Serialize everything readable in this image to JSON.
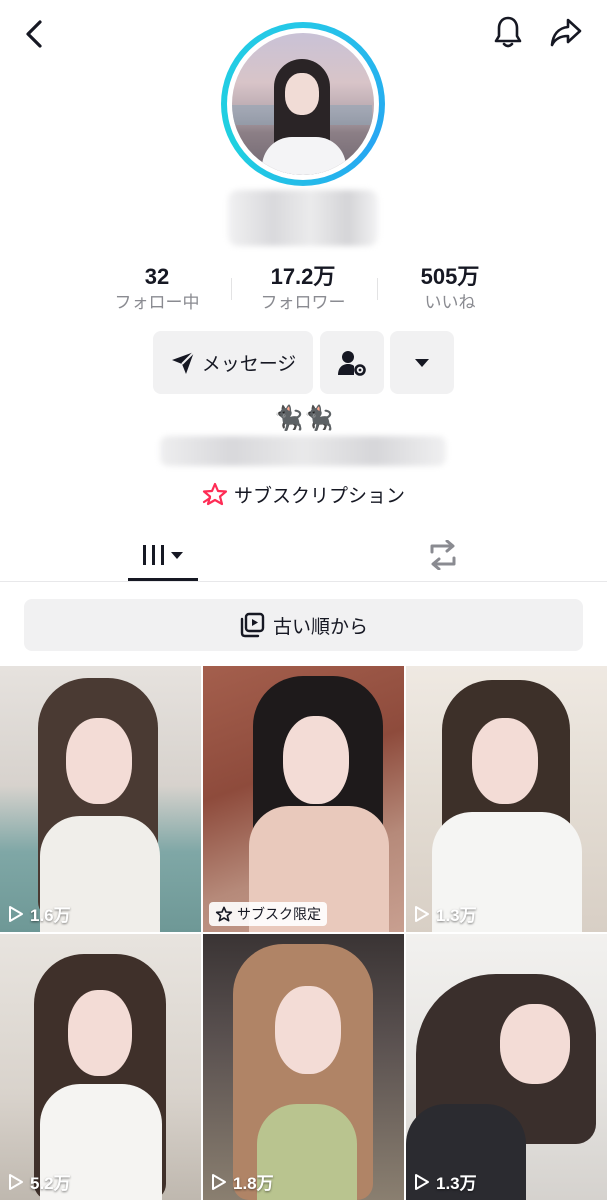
{
  "header": {
    "back_icon": "chevron-left-icon",
    "bell_icon": "bell-icon",
    "share_icon": "share-arrow-icon"
  },
  "profile": {
    "stats": [
      {
        "value": "32",
        "label": "フォロー中"
      },
      {
        "value": "17.2万",
        "label": "フォロワー"
      },
      {
        "value": "505万",
        "label": "いいね"
      }
    ],
    "message_button": "メッセージ",
    "friend_settings_icon": "person-gear-icon",
    "more_icon": "caret-down-icon",
    "bio_emoji": "🐈‍⬛🐈‍⬛",
    "subscription_label": "サブスクリプション"
  },
  "tabs": {
    "videos_icon": "grid-columns-icon",
    "repost_icon": "repost-icon"
  },
  "sort": {
    "label": "古い順から"
  },
  "videos": [
    {
      "views": "1.6万",
      "badge": ""
    },
    {
      "views": "",
      "badge": "サブスク限定"
    },
    {
      "views": "1.3万",
      "badge": ""
    },
    {
      "views": "5.2万",
      "badge": ""
    },
    {
      "views": "1.8万",
      "badge": ""
    },
    {
      "views": "1.3万",
      "badge": ""
    }
  ],
  "colors": {
    "ring": "#25c7e8",
    "button_bg": "#f1f1f2",
    "text": "#161823",
    "muted": "#8a8b91",
    "subscription_pink": "#fe2c55"
  }
}
